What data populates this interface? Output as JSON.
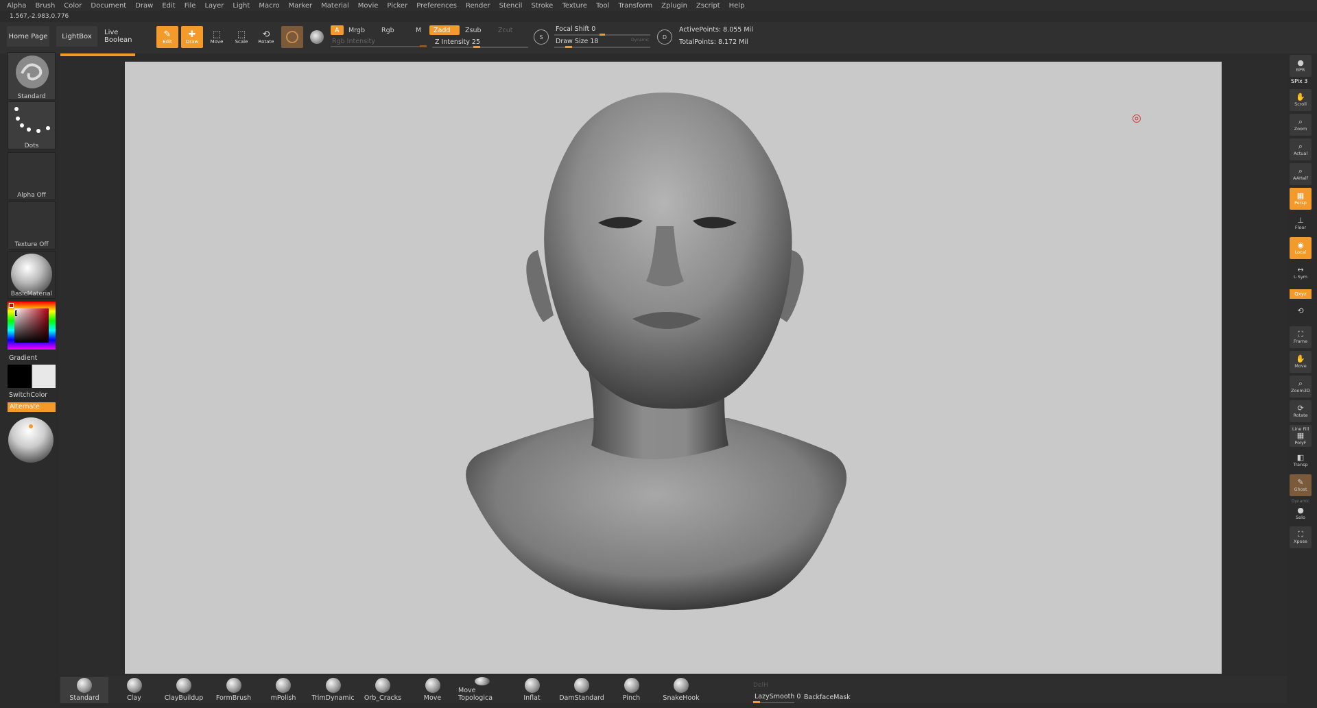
{
  "menu": [
    "Alpha",
    "Brush",
    "Color",
    "Document",
    "Draw",
    "Edit",
    "File",
    "Layer",
    "Light",
    "Macro",
    "Marker",
    "Material",
    "Movie",
    "Picker",
    "Preferences",
    "Render",
    "Stencil",
    "Stroke",
    "Texture",
    "Tool",
    "Transform",
    "Zplugin",
    "Zscript",
    "Help"
  ],
  "coords": "1.567,-2.983,0.776",
  "toolbar": {
    "home_page": "Home Page",
    "lightbox": "LightBox",
    "live_boolean": "Live Boolean",
    "edit": "Edit",
    "draw": "Draw",
    "move": "Move",
    "scale": "Scale",
    "rotate": "Rotate",
    "a": "A",
    "mrgb": "Mrgb",
    "rgb": "Rgb",
    "m": "M",
    "rgb_intensity": "Rgb Intensity",
    "zadd": "Zadd",
    "zsub": "Zsub",
    "zcut": "Zcut",
    "z_intensity": "Z Intensity 25",
    "z_intensity_value": 25,
    "focal_shift": "Focal Shift 0",
    "draw_size": "Draw Size 18",
    "dynamic": "Dynamic",
    "active_points": "ActivePoints: 8.055 Mil",
    "total_points": "TotalPoints: 8.172 Mil",
    "s_label": "S",
    "d_label": "D"
  },
  "left": {
    "standard": "Standard",
    "dots": "Dots",
    "alpha_off": "Alpha Off",
    "texture_off": "Texture Off",
    "basic_material": "BasicMaterial",
    "gradient": "Gradient",
    "switch_color": "SwitchColor",
    "alternate": "Alternate"
  },
  "right": {
    "bpr": "BPR",
    "spix": "SPix 3",
    "scroll": "Scroll",
    "zoom": "Zoom",
    "actual": "Actual",
    "aahalf": "AAHalf",
    "persp": "Persp",
    "floor": "Floor",
    "local": "Local",
    "lsym": "L.Sym",
    "xyz": "Qxyz",
    "frame": "Frame",
    "move": "Move",
    "zoom3d": "Zoom3D",
    "rotate": "Rotate",
    "line_fill": "Line Fill",
    "polyf": "PolyF",
    "transp": "Transp",
    "ghost": "Ghost",
    "dynamic": "Dynamic",
    "solo": "Solo",
    "xpose": "Xpose"
  },
  "brushes": [
    "Standard",
    "Clay",
    "ClayBuildup",
    "FormBrush",
    "mPolish",
    "TrimDynamic",
    "Orb_Cracks",
    "Move",
    "Move Topologica",
    "Inflat",
    "DamStandard",
    "Pinch",
    "SnakeHook"
  ],
  "bottom": {
    "delh": "DelH",
    "lazy_smooth": "LazySmooth 0",
    "backface_mask": "BackfaceMask"
  },
  "colors": {
    "accent": "#f39a2b",
    "viewport_bg": "#c9c9c9"
  }
}
